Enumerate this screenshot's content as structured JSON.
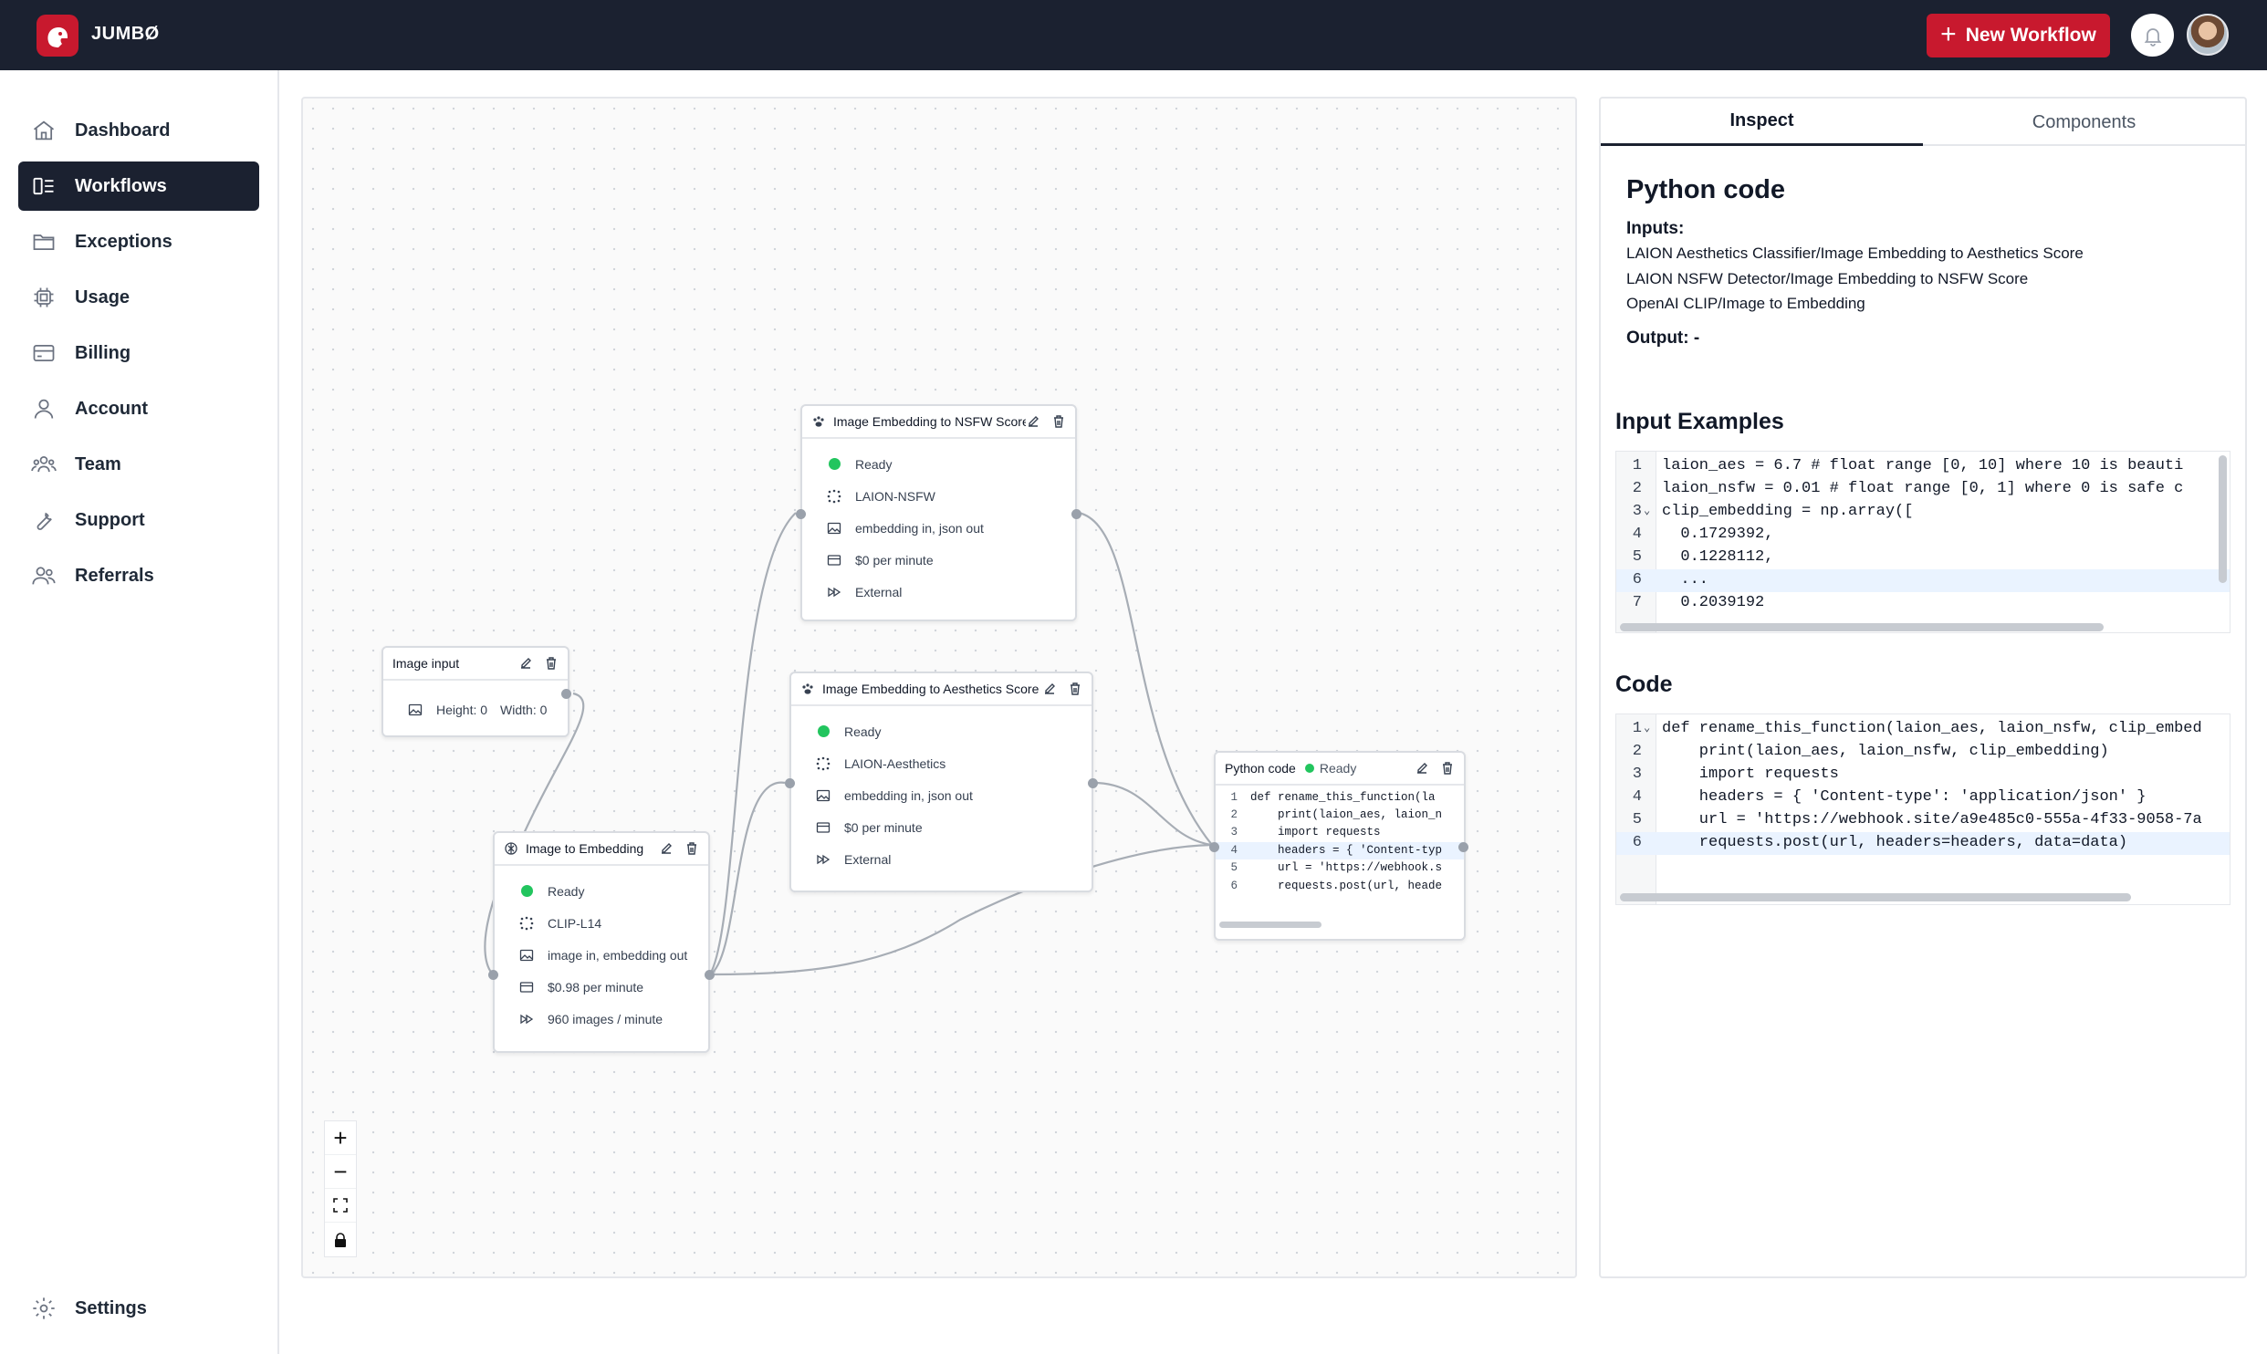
{
  "brand": {
    "name": "JUMBØ"
  },
  "header": {
    "new_workflow_label": "New Workflow"
  },
  "sidebar": {
    "items": [
      {
        "label": "Dashboard",
        "icon": "home-icon"
      },
      {
        "label": "Workflows",
        "icon": "workflow-icon"
      },
      {
        "label": "Exceptions",
        "icon": "folder-icon"
      },
      {
        "label": "Usage",
        "icon": "cpu-icon"
      },
      {
        "label": "Billing",
        "icon": "credit-card-icon"
      },
      {
        "label": "Account",
        "icon": "user-icon"
      },
      {
        "label": "Team",
        "icon": "team-icon"
      },
      {
        "label": "Support",
        "icon": "wrench-icon"
      },
      {
        "label": "Referrals",
        "icon": "users-icon"
      }
    ],
    "settings_label": "Settings",
    "active_item": "Workflows"
  },
  "nodes": {
    "nsfw": {
      "title": "Image Embedding to NSFW Score",
      "status": "Ready",
      "model": "LAION-NSFW",
      "io": "embedding in, json out",
      "price": "$0 per minute",
      "speed": "External"
    },
    "aesthetics": {
      "title": "Image Embedding to Aesthetics Score",
      "status": "Ready",
      "model": "LAION-Aesthetics",
      "io": "embedding in, json out",
      "price": "$0 per minute",
      "speed": "External"
    },
    "image_input": {
      "title": "Image input",
      "height": "Height: 0",
      "width": "Width: 0"
    },
    "image_to_embedding": {
      "title": "Image to Embedding",
      "status": "Ready",
      "model": "CLIP-L14",
      "io": "image in, embedding out",
      "price": "$0.98 per minute",
      "speed": "960 images / minute"
    },
    "python": {
      "title": "Python code",
      "status": "Ready",
      "code_lines": [
        "def rename_this_function(la",
        "    print(laion_aes, laion_n",
        "    import requests",
        "    headers = { 'Content-typ",
        "    url = 'https://webhook.s",
        "    requests.post(url, heade"
      ]
    }
  },
  "panel": {
    "tabs": [
      "Inspect",
      "Components"
    ],
    "active_tab": "Inspect",
    "title": "Python code",
    "inputs_label": "Inputs:",
    "inputs": [
      "LAION Aesthetics Classifier/Image Embedding to Aesthetics Score",
      "LAION NSFW Detector/Image Embedding to NSFW Score",
      "OpenAI CLIP/Image to Embedding"
    ],
    "output_label": "Output: -",
    "input_examples_heading": "Input Examples",
    "input_examples": [
      "laion_aes = 6.7 # float range [0, 10] where 10 is beauti",
      "laion_nsfw = 0.01 # float range [0, 1] where 0 is safe c",
      "clip_embedding = np.array([",
      "  0.1729392,",
      "  0.1228112,",
      "  ...",
      "  0.2039192"
    ],
    "code_heading": "Code",
    "code": [
      "def rename_this_function(laion_aes, laion_nsfw, clip_embed",
      "    print(laion_aes, laion_nsfw, clip_embedding)",
      "    import requests",
      "    headers = { 'Content-type': 'application/json' }",
      "    url = 'https://webhook.site/a9e485c0-555a-4f33-9058-7a",
      "    requests.post(url, headers=headers, data=data)"
    ]
  },
  "zoom_controls": [
    "+",
    "−",
    "fit-view-icon",
    "lock-icon"
  ]
}
